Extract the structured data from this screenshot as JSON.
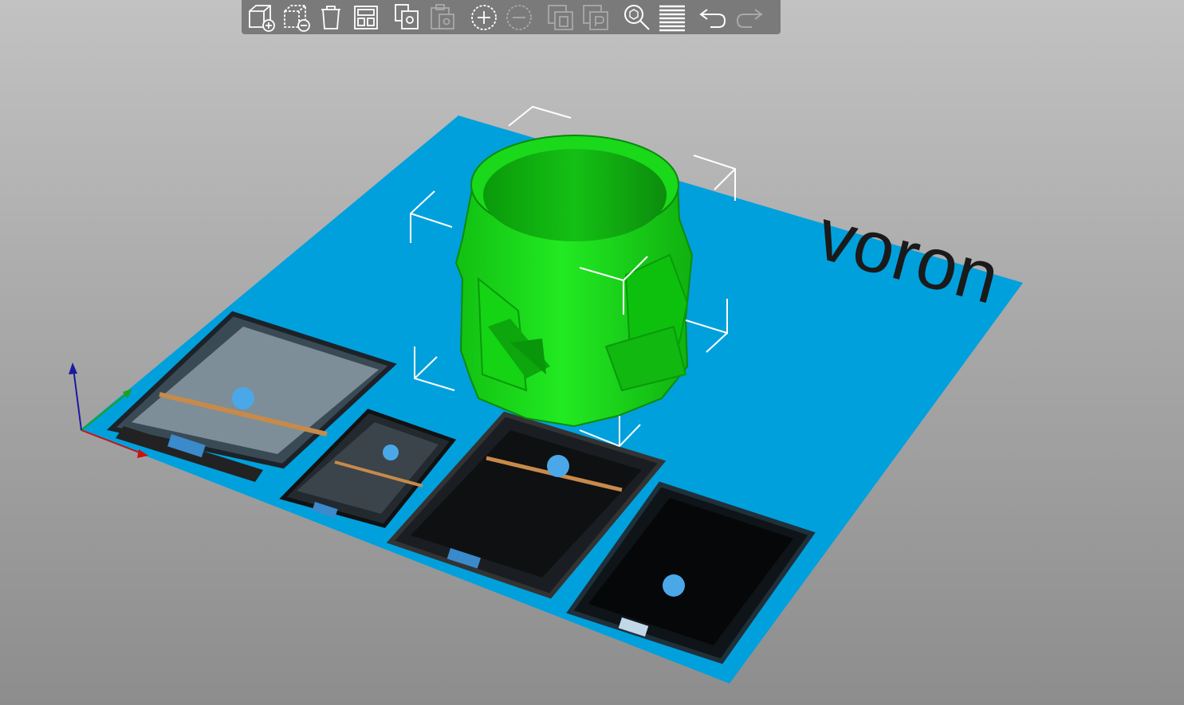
{
  "scene": {
    "bed_logo_text": "voron",
    "bed_color": "#00a0dd",
    "model_color": "#1be51b",
    "bounding_box_color": "#ffffff",
    "background_top": "#c2c2c2",
    "background_bottom": "#8d8d8d",
    "axis_colors": {
      "x": "#d01010",
      "y": "#1aa31a",
      "z": "#1a1aa0"
    }
  },
  "toolbar": {
    "buttons": [
      {
        "icon": "add-icon",
        "enabled": true
      },
      {
        "icon": "delete-icon",
        "enabled": true
      },
      {
        "icon": "delete-all-icon",
        "enabled": true
      },
      {
        "icon": "arrange-icon",
        "enabled": true
      },
      {
        "icon": "copy-icon",
        "enabled": true
      },
      {
        "icon": "paste-icon",
        "enabled": false
      },
      {
        "icon": "add-instance-icon",
        "enabled": true
      },
      {
        "icon": "remove-instance-icon",
        "enabled": false
      },
      {
        "icon": "split-objects-icon",
        "enabled": false
      },
      {
        "icon": "split-parts-icon",
        "enabled": false
      },
      {
        "icon": "search-icon",
        "enabled": true
      },
      {
        "icon": "layers-editing-icon",
        "enabled": true
      },
      {
        "icon": "undo-icon",
        "enabled": true
      },
      {
        "icon": "redo-icon",
        "enabled": false
      }
    ]
  }
}
